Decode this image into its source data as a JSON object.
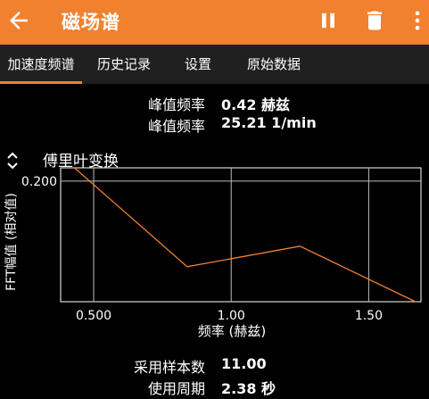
{
  "appbar": {
    "title": "磁场谱",
    "icons": [
      "back-arrow-icon",
      "pause-icon",
      "trash-icon",
      "more-vertical-icon"
    ]
  },
  "tabs": [
    {
      "label": "加速度频谱",
      "active": true
    },
    {
      "label": "历史记录",
      "active": false
    },
    {
      "label": "设置",
      "active": false
    },
    {
      "label": "原始数据",
      "active": false
    }
  ],
  "peak": {
    "freq_label": "峰值频率",
    "freq_value": "0.42 赫兹",
    "freq2_label": "峰值频率",
    "freq2_value": "25.21 1/min"
  },
  "chart": {
    "title": "傅里叶变换"
  },
  "chart_data": {
    "type": "line",
    "title": "傅里叶变换",
    "xlabel": "频率 (赫兹)",
    "ylabel": "FFT幅值 (相对值)",
    "xlim": [
      0.38,
      1.69
    ],
    "ylim": [
      0.0,
      0.222
    ],
    "x_ticks": [
      0.5,
      1.0,
      1.5
    ],
    "x_tick_labels": [
      "0.500",
      "1.00",
      "1.50"
    ],
    "y_ticks": [
      0.2
    ],
    "y_tick_labels": [
      "0.200"
    ],
    "grid": true,
    "color": "#f0812f",
    "series": [
      {
        "x": [
          0.43,
          0.84,
          1.25,
          1.67
        ],
        "y": [
          0.222,
          0.058,
          0.092,
          0.0
        ]
      }
    ]
  },
  "stats": {
    "samples_label": "采用样本数",
    "samples_value": "11.00",
    "period_label": "使用周期",
    "period_value": "2.38 秒"
  }
}
